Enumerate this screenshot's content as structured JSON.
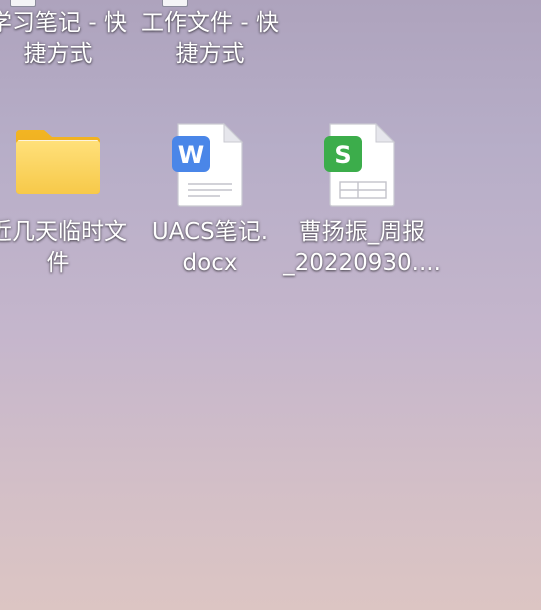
{
  "desktop": {
    "icons": [
      {
        "label": "学习笔记 - 快\n捷方式",
        "type": "shortcut"
      },
      {
        "label": "工作文件 - 快\n捷方式",
        "type": "shortcut"
      },
      {
        "label": "近几天临时文\n件",
        "type": "folder",
        "icon": "folder-icon"
      },
      {
        "label": "UACS笔记.\ndocx",
        "type": "wps-writer-document",
        "icon": "wps-writer-icon",
        "badge": "W"
      },
      {
        "label": "曹扬振_周报\n_20220930....",
        "type": "wps-spreadsheet",
        "icon": "wps-spreadsheet-icon",
        "badge": "S"
      }
    ],
    "colors": {
      "writer_badge": "#4a86e8",
      "sheet_badge": "#3cad4b",
      "folder": "#f6c542"
    }
  }
}
